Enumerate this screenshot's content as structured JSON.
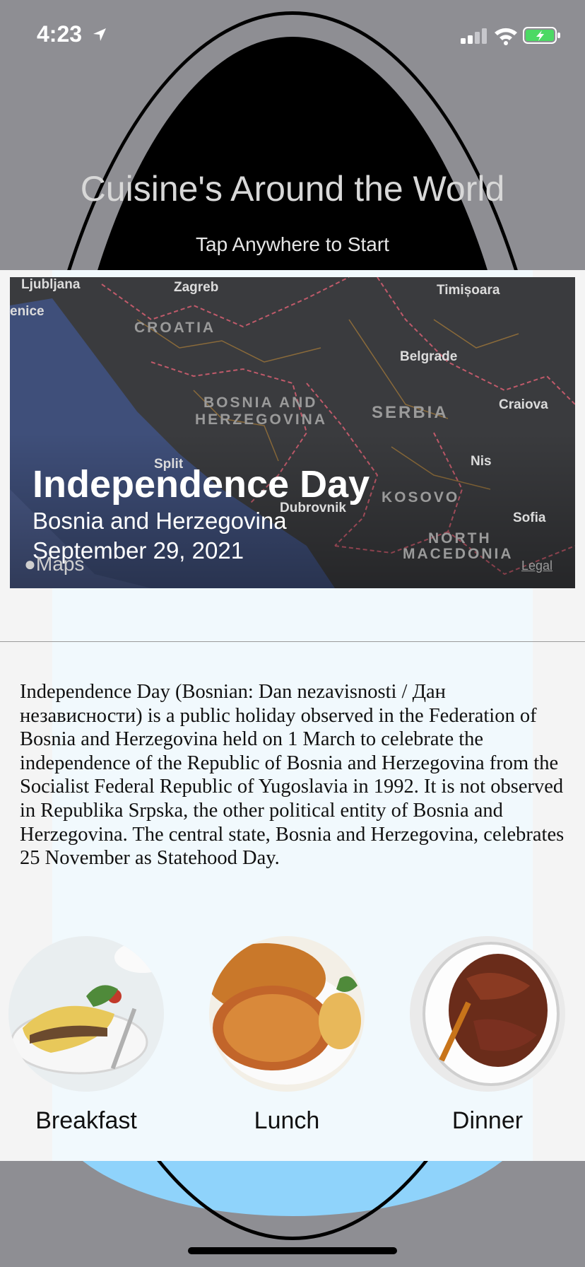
{
  "status_bar": {
    "time": "4:23"
  },
  "splash": {
    "title": "Cuisine's Around the World",
    "subtitle": "Tap Anywhere to Start"
  },
  "map": {
    "cities": [
      "Ljubljana",
      "Zagreb",
      "Timișoara",
      "enice",
      "Belgrade",
      "Craiova",
      "Split",
      "Nis",
      "Dubrovnik",
      "Sofia"
    ],
    "countries": [
      "CROATIA",
      "BOSNIA AND",
      "HERZEGOVINA",
      "SERBIA",
      "KOSOVO",
      "NORTH",
      "MACEDONIA"
    ],
    "attribution": "Maps",
    "legal": "Legal"
  },
  "holiday": {
    "name": "Independence Day",
    "country": "Bosnia and Herzegovina",
    "date": "September 29, 2021",
    "description": "Independence Day (Bosnian: Dan nezavisnosti / Дан независности) is a public holiday observed in the Federation of Bosnia and Herzegovina held on 1 March to celebrate the independence of the Republic of Bosnia and Herzegovina from the Socialist Federal Republic of Yugoslavia in 1992. It is not observed in Republika Srpska, the other political entity of Bosnia and Herzegovina. The central state, Bosnia and Herzegovina, celebrates 25 November as Statehood Day."
  },
  "meals": [
    {
      "label": "Breakfast"
    },
    {
      "label": "Lunch"
    },
    {
      "label": "Dinner"
    }
  ],
  "colors": {
    "background": "#8e8e93",
    "sky": "#8fd3fb",
    "battery": "#4cd964"
  }
}
